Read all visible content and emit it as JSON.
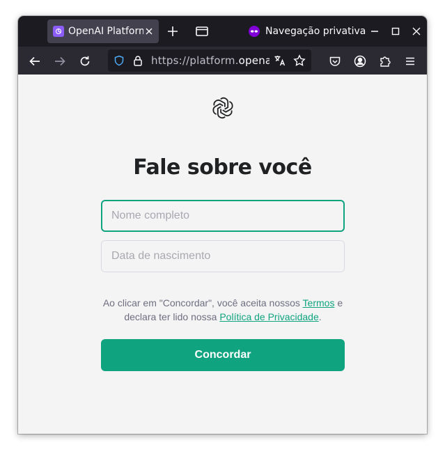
{
  "browser": {
    "tab": {
      "title": "OpenAI Platform",
      "favicon": "openai-favicon-icon"
    },
    "private_label": "Navegação privativa",
    "url": {
      "prefix": "https://platform.",
      "host": "openai.com",
      "display_full": "https://platform.openai.com"
    },
    "colors": {
      "tabbar": "#1c1b22",
      "navbar": "#2b2a33",
      "active_tab": "#42414d",
      "private": "#8000d7"
    }
  },
  "page": {
    "logo": "openai-logo-icon",
    "title": "Fale sobre você",
    "fields": {
      "full_name": {
        "value": "",
        "placeholder": "Nome completo"
      },
      "birth_date": {
        "value": "",
        "placeholder": "Data de nascimento"
      }
    },
    "terms": {
      "part1": "Ao clicar em \"Concordar\", você aceita nossos ",
      "terms_link": "Termos",
      "part2": " e declara ter lido nossa ",
      "privacy_link": "Política de Privacidade",
      "part3": "."
    },
    "submit_label": "Concordar",
    "colors": {
      "accent": "#10a37f",
      "heading": "#202123",
      "muted": "#6e6e80",
      "background": "#f4f4f4"
    }
  }
}
